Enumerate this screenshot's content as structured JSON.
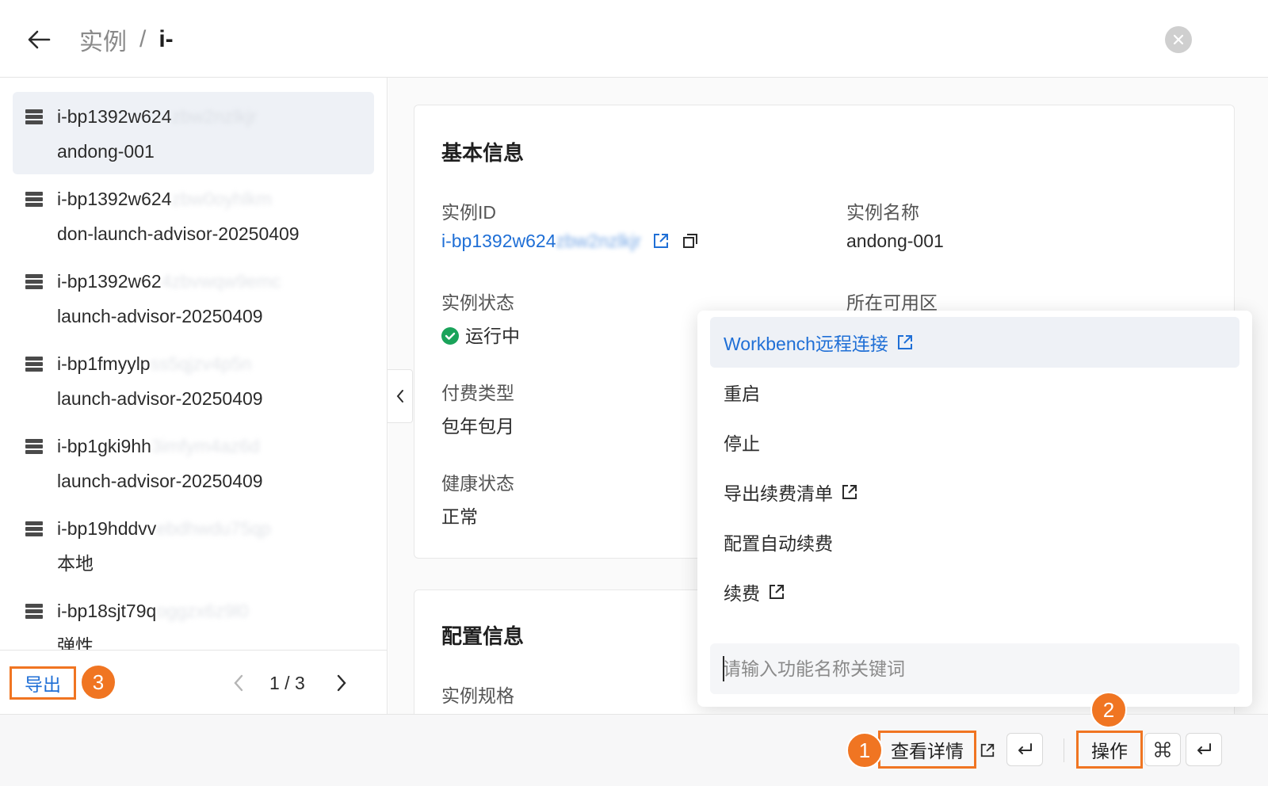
{
  "header": {
    "breadcrumb_parent": "实例",
    "breadcrumb_separator": "/",
    "breadcrumb_current": "i-"
  },
  "instances": [
    {
      "id_visible": "i-bp1392w624",
      "id_blurred": "zbw2nzlkjr",
      "name": "andong-001",
      "selected": true
    },
    {
      "id_visible": "i-bp1392w624",
      "id_blurred": "zbw0oyhlkm",
      "name": "don-launch-advisor-20250409"
    },
    {
      "id_visible": "i-bp1392w62",
      "id_blurred": "4zbvwqw9emc",
      "name": "launch-advisor-20250409"
    },
    {
      "id_visible": "i-bp1fmyylp",
      "id_blurred": "ss5qjzv4p5n",
      "name": "launch-advisor-20250409"
    },
    {
      "id_visible": "i-bp1gki9hh",
      "id_blurred": "3imfym4az6d",
      "name": "launch-advisor-20250409"
    },
    {
      "id_visible": "i-bp19hddvv",
      "id_blurred": "ebdhwdu75qp",
      "name": "本地"
    },
    {
      "id_visible": "i-bp18sjt79q",
      "id_blurred": "oggzx6z9l0",
      "name": "弹性"
    }
  ],
  "left_footer": {
    "export_label": "导出",
    "page_text": "1 / 3"
  },
  "basic_info": {
    "title": "基本信息",
    "instance_id_label": "实例ID",
    "instance_id_visible": "i-bp1392w624",
    "instance_id_blurred": "zbw2nzlkjr",
    "instance_name_label": "实例名称",
    "instance_name_value": "andong-001",
    "status_label": "实例状态",
    "status_value": "运行中",
    "zone_label": "所在可用区",
    "billing_label": "付费类型",
    "billing_value": "包年包月",
    "health_label": "健康状态",
    "health_value": "正常"
  },
  "config_info": {
    "title": "配置信息",
    "spec_label": "实例规格"
  },
  "action_menu": {
    "items": [
      {
        "label": "Workbench远程连接",
        "external": true
      },
      {
        "label": "重启",
        "external": false
      },
      {
        "label": "停止",
        "external": false
      },
      {
        "label": "导出续费清单",
        "external": true
      },
      {
        "label": "配置自动续费",
        "external": false
      },
      {
        "label": "续费",
        "external": true
      }
    ],
    "search_placeholder": "请输入功能名称关键词"
  },
  "bottom_bar": {
    "detail_label": "查看详情",
    "action_label": "操作"
  },
  "badges": {
    "one": "1",
    "two": "2",
    "three": "3"
  },
  "colors": {
    "accent": "#1f6fd6",
    "highlight": "#f07522",
    "success": "#1aa35a"
  }
}
